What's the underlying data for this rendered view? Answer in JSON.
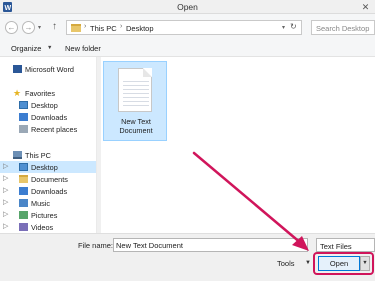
{
  "window": {
    "title": "Open",
    "close_glyph": "✕"
  },
  "nav": {
    "back_glyph": "←",
    "forward_glyph": "→",
    "recent_glyph": "▾",
    "up_glyph": "↑",
    "breadcrumb": [
      "This PC",
      "Desktop"
    ],
    "breadcrumb_sep": "›",
    "refresh_glyph": "↻",
    "dropdown_glyph": "▾",
    "search_placeholder": "Search Desktop"
  },
  "toolbar": {
    "organize_label": "Organize",
    "organize_caret": "▼",
    "new_folder_label": "New folder"
  },
  "sidebar": {
    "items": [
      {
        "label": "Microsoft Word",
        "icon": "word-icon"
      },
      {
        "label": "Favorites",
        "icon": "star-icon"
      },
      {
        "label": "Desktop",
        "icon": "desktop-icon"
      },
      {
        "label": "Downloads",
        "icon": "downloads-icon"
      },
      {
        "label": "Recent places",
        "icon": "recent-places-icon"
      },
      {
        "label": "This PC",
        "icon": "computer-icon"
      },
      {
        "label": "Desktop",
        "icon": "desktop-icon",
        "selected": true
      },
      {
        "label": "Documents",
        "icon": "documents-icon"
      },
      {
        "label": "Downloads",
        "icon": "downloads-icon"
      },
      {
        "label": "Music",
        "icon": "music-icon"
      },
      {
        "label": "Pictures",
        "icon": "pictures-icon"
      },
      {
        "label": "Videos",
        "icon": "videos-icon"
      }
    ],
    "expand_glyph": "▷"
  },
  "files": [
    {
      "name": "New Text Document",
      "icon": "text-document-icon",
      "selected": true
    }
  ],
  "footer": {
    "file_name_label": "File name:",
    "file_name_value": "New Text Document",
    "filter_label": "Text Files",
    "tools_label": "Tools",
    "tools_caret": "▼",
    "open_label": "Open",
    "open_split_glyph": "▼"
  },
  "colors": {
    "annotation": "#d0155b",
    "selection": "#cce8ff",
    "accent": "#0078d7"
  }
}
